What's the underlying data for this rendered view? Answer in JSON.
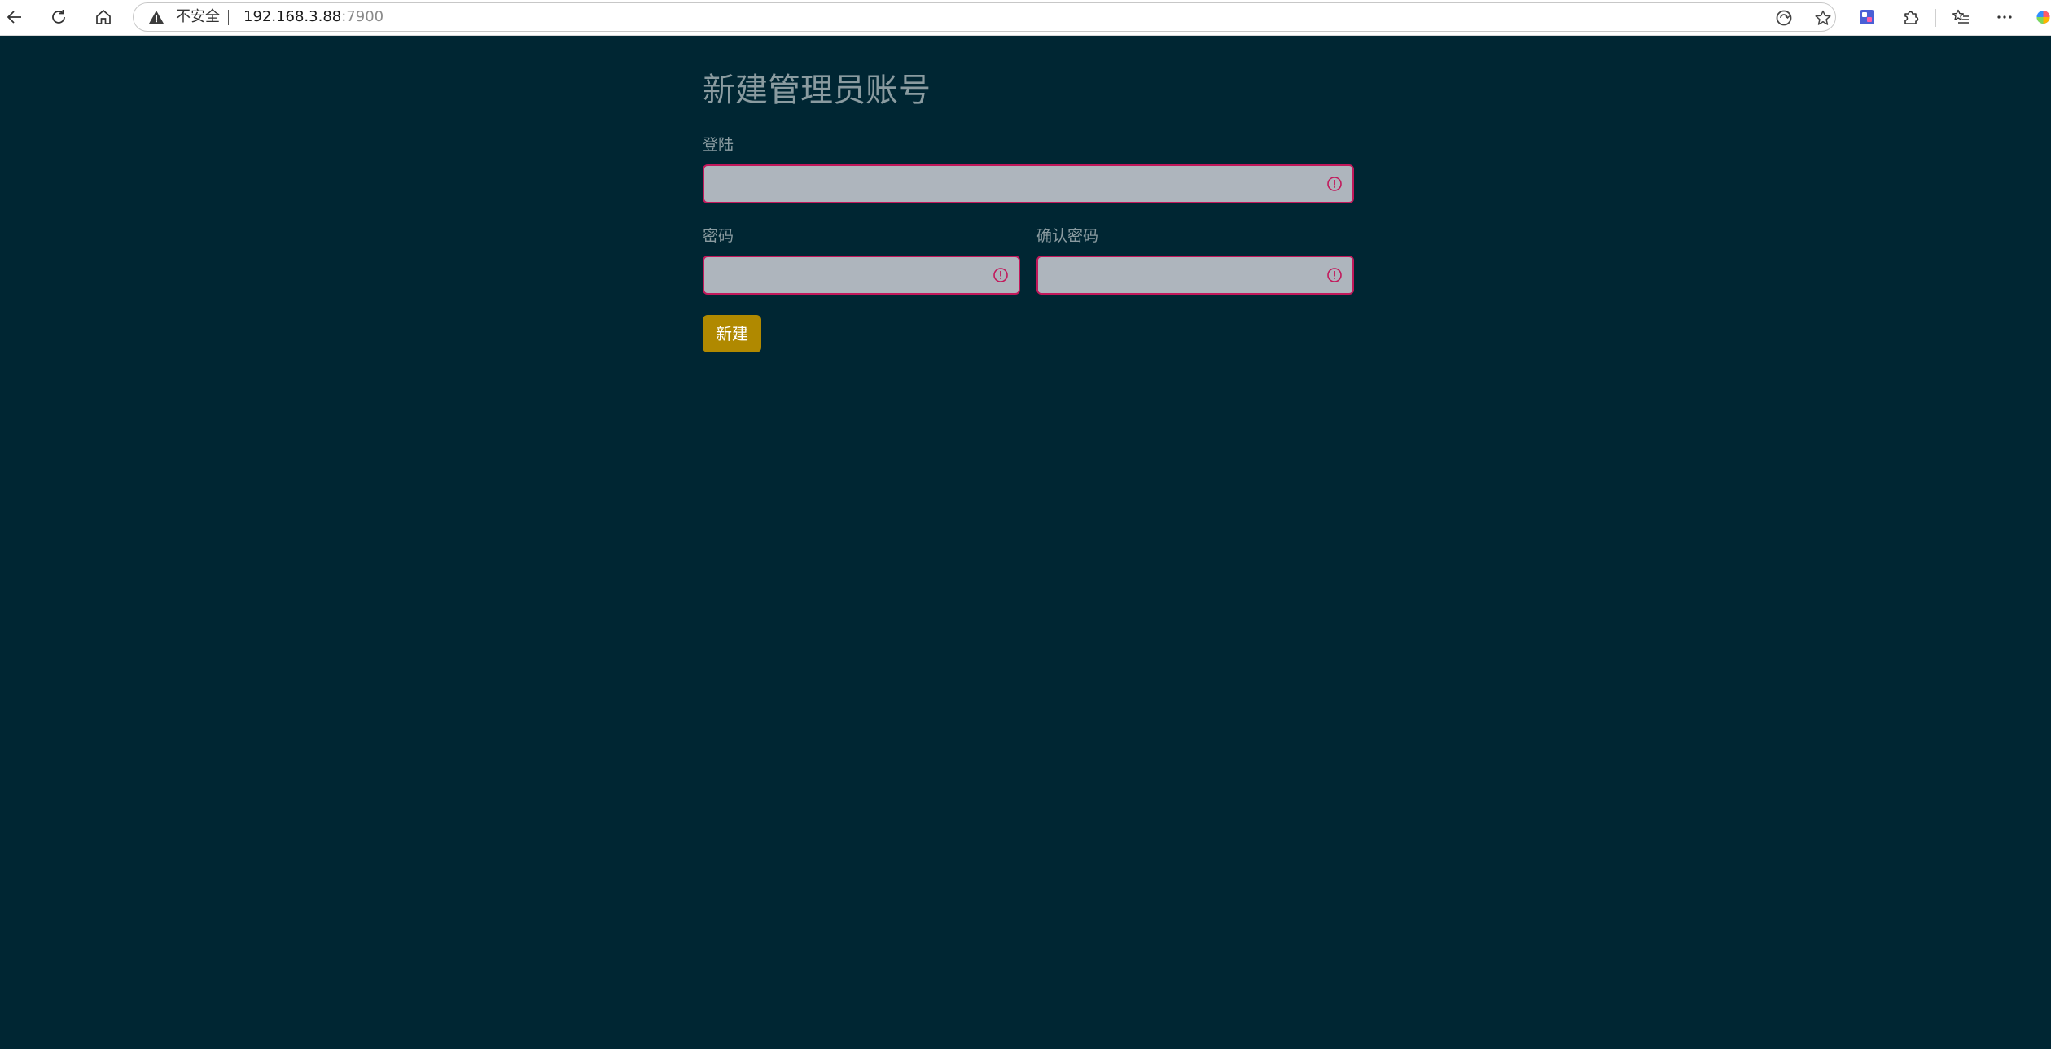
{
  "browser": {
    "security_label": "不安全",
    "url_host": "192.168.3.88",
    "url_port": ":7900",
    "icons": {
      "back": "back-arrow-icon",
      "reload": "reload-icon",
      "home": "home-icon",
      "warning": "warning-triangle-icon",
      "read_aloud": "read-aloud-icon",
      "favorite": "star-icon",
      "extension": "extension-app-icon",
      "extensions": "puzzle-icon",
      "favorites": "favorites-list-icon",
      "more": "more-icon",
      "copilot": "copilot-icon"
    }
  },
  "form": {
    "title": "新建管理员账号",
    "login_label": "登陆",
    "login_value": "",
    "password_label": "密码",
    "password_value": "",
    "confirm_label": "确认密码",
    "confirm_value": "",
    "submit_label": "新建"
  },
  "colors": {
    "page_background": "#002633",
    "input_background": "#aeb5bd",
    "invalid_border": "#c2185b",
    "button": "#b08900",
    "label_text": "#8a9ba0"
  }
}
